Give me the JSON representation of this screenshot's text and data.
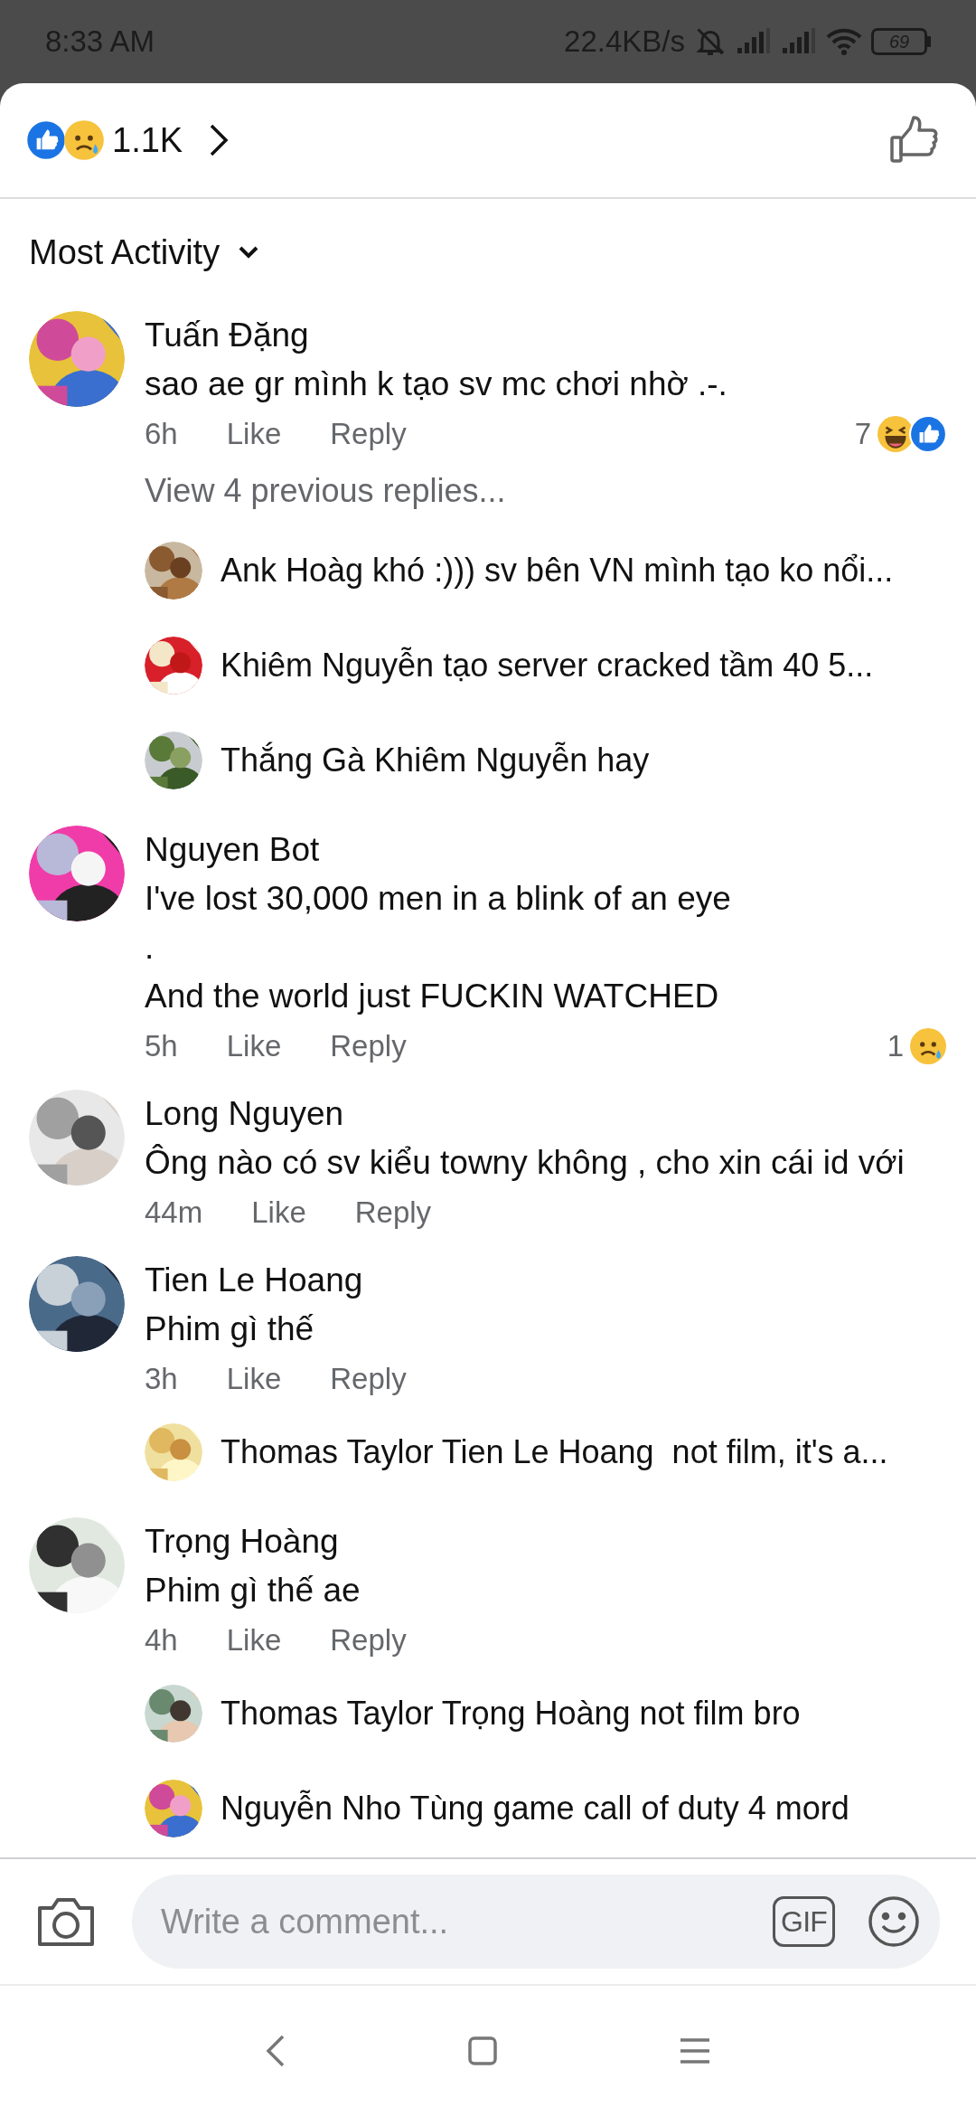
{
  "status_bar": {
    "time": "8:33 AM",
    "net_speed": "22.4KB/s",
    "battery": "69"
  },
  "header": {
    "reactions": [
      {
        "kind": "like"
      },
      {
        "kind": "sad"
      }
    ],
    "count": "1.1K"
  },
  "sort": {
    "label": "Most Activity"
  },
  "comments": [
    {
      "name": "Tuấn Đặng",
      "text": "sao ae gr mình k tạo sv mc chơi nhờ .-.",
      "time": "6h",
      "like": "Like",
      "reply": "Reply",
      "reaction_count": "7",
      "reactions": [
        {
          "kind": "haha"
        },
        {
          "kind": "like"
        }
      ],
      "view_previous": "View 4 previous replies...",
      "replies": [
        {
          "text": "Ank Hoàg khó :))) sv bên VN mình tạo ko nổi..."
        },
        {
          "text": "Khiêm Nguyễn tạo server cracked tầm 40 5..."
        },
        {
          "text": "Thắng Gà Khiêm Nguyễn hay"
        }
      ]
    },
    {
      "name": "Nguyen Bot",
      "text": "I've lost 30,000 men in a blink of an eye\n.\nAnd the world just FUCKIN WATCHED",
      "time": "5h",
      "like": "Like",
      "reply": "Reply",
      "reaction_count": "1",
      "reactions": [
        {
          "kind": "sad"
        }
      ]
    },
    {
      "name": "Long Nguyen",
      "text": "Ông nào có sv kiểu towny không , cho xin cái id với",
      "time": "44m",
      "like": "Like",
      "reply": "Reply"
    },
    {
      "name": "Tien Le Hoang",
      "text": "Phim gì thế",
      "time": "3h",
      "like": "Like",
      "reply": "Reply",
      "replies": [
        {
          "text": "Thomas Taylor Tien Le Hoang  not film, it's a..."
        }
      ]
    },
    {
      "name": "Trọng Hoàng",
      "text": "Phim gì thế ae",
      "time": "4h",
      "like": "Like",
      "reply": "Reply",
      "replies": [
        {
          "text": "Thomas Taylor Trọng Hoàng not film bro"
        },
        {
          "text": "Nguyễn Nho Tùng game call of duty 4 mord"
        }
      ]
    }
  ],
  "composer": {
    "placeholder": "Write a comment...",
    "gif": "GIF"
  }
}
